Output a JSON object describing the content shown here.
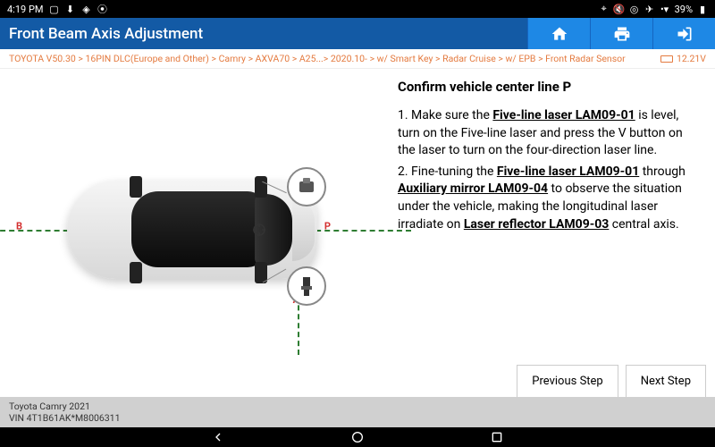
{
  "statusbar": {
    "time": "4:19 PM",
    "battery": "39%"
  },
  "title": "Front Beam Axis Adjustment",
  "breadcrumb": "TOYOTA V50.30 > 16PIN DLC(Europe and Other) > Camry > AXVA70 > A25...> 2020.10- > w/ Smart Key > Radar Cruise > w/ EPB > Front Radar Sensor",
  "voltage": "12.21V",
  "diagram": {
    "labelB": "B",
    "labelP": "P",
    "labelA": "A"
  },
  "instructions": {
    "heading": "Confirm vehicle center line P",
    "step1_a": "1. Make sure the ",
    "step1_b": " is level, turn on the Five-line laser and press the V button on the laser to turn on the four-direction laser line.",
    "step2_a": "2. Fine-tuning the ",
    "step2_b": " through ",
    "step2_c": " to observe the situation under the vehicle, making the longitudinal laser irradiate on ",
    "step2_d": " central axis.",
    "tool1": "Five-line laser LAM09-01",
    "tool2": "Five-line laser LAM09-01",
    "tool3": "Auxiliary mirror LAM09-04",
    "tool4": "Laser reflector LAM09-03"
  },
  "nav": {
    "prev": "Previous Step",
    "next": "Next Step"
  },
  "footer": {
    "model": "Toyota Camry 2021",
    "vin": "VIN 4T1B61AK*M8006311"
  }
}
